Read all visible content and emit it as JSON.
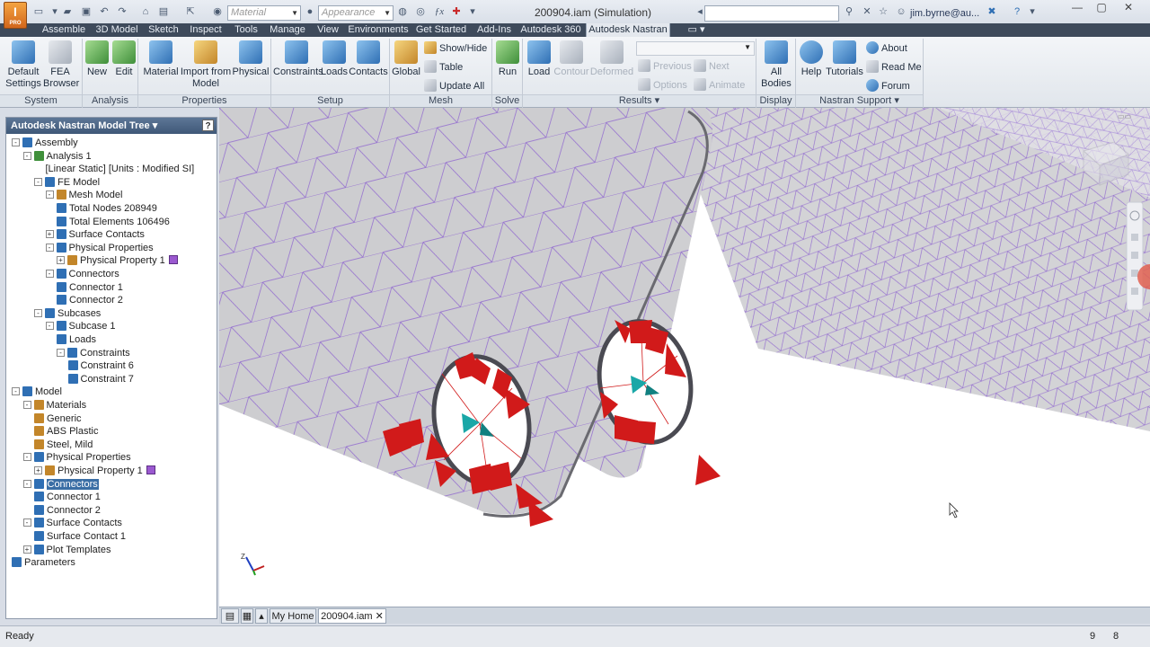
{
  "app": {
    "window_title": "200904.iam (Simulation)",
    "user": "jim.byrne@au...",
    "app_button_label": "PRO",
    "material_placeholder": "Material",
    "appearance_placeholder": "Appearance"
  },
  "tabs": [
    "Assemble",
    "3D Model",
    "Sketch",
    "Inspect",
    "Tools",
    "Manage",
    "View",
    "Environments",
    "Get Started",
    "Add-Ins",
    "Autodesk 360",
    "Autodesk Nastran"
  ],
  "active_tab": "Autodesk Nastran",
  "ribbon": {
    "system": {
      "label": "System",
      "default_settings": "Default Settings",
      "fea_browser": "FEA Browser"
    },
    "analysis": {
      "label": "Analysis",
      "new": "New",
      "edit": "Edit"
    },
    "properties": {
      "label": "Properties",
      "material": "Material",
      "import_from_model": "Import from Model",
      "physical": "Physical"
    },
    "setup": {
      "label": "Setup",
      "constraints": "Constraints",
      "loads": "Loads",
      "contacts": "Contacts"
    },
    "mesh": {
      "label": "Mesh",
      "global": "Global",
      "show_hide": "Show/Hide",
      "table": "Table",
      "update_all": "Update  All"
    },
    "solve": {
      "label": "Solve",
      "run": "Run"
    },
    "results": {
      "label": "Results",
      "load": "Load",
      "contour": "Contour",
      "deformed": "Deformed",
      "previous": "Previous",
      "next": "Next",
      "options": "Options",
      "animate": "Animate"
    },
    "display": {
      "label": "Display",
      "all_bodies": "All Bodies"
    },
    "support": {
      "label": "Nastran Support",
      "help": "Help",
      "tutorials": "Tutorials",
      "about": "About",
      "read_me": "Read Me",
      "forum": "Forum"
    }
  },
  "tree": {
    "header": "Autodesk Nastran Model Tree",
    "help": "?",
    "items": [
      {
        "label": "Assembly",
        "level": 0,
        "exp": "-",
        "icon": "assembly-icon",
        "color": "#2f6fb4"
      },
      {
        "label": "Analysis 1",
        "level": 1,
        "exp": "-",
        "icon": "analysis-icon",
        "color": "#3f8f3a"
      },
      {
        "label": "[Linear Static] [Units : Modified SI]",
        "level": 3,
        "exp": "",
        "icon": "",
        "color": ""
      },
      {
        "label": "FE Model",
        "level": 2,
        "exp": "-",
        "icon": "fe-model-icon",
        "color": "#2f6fb4"
      },
      {
        "label": "Mesh Model",
        "level": 3,
        "exp": "-",
        "icon": "mesh-icon",
        "color": "#c3862a"
      },
      {
        "label": "Total Nodes 208949",
        "level": 4,
        "exp": "",
        "icon": "node-icon",
        "color": "#2f6fb4"
      },
      {
        "label": "Total Elements 106496",
        "level": 4,
        "exp": "",
        "icon": "element-icon",
        "color": "#2f6fb4"
      },
      {
        "label": "Surface Contacts",
        "level": 3,
        "exp": "+",
        "icon": "contact-icon",
        "color": "#2f6fb4"
      },
      {
        "label": "Physical Properties",
        "level": 3,
        "exp": "-",
        "icon": "properties-icon",
        "color": "#2f6fb4"
      },
      {
        "label": "Physical Property 1",
        "level": 4,
        "exp": "+",
        "icon": "property-icon",
        "color": "#c3862a",
        "swatch": true
      },
      {
        "label": "Connectors",
        "level": 3,
        "exp": "-",
        "icon": "connector-icon",
        "color": "#2f6fb4"
      },
      {
        "label": "Connector 1",
        "level": 4,
        "exp": "",
        "icon": "connector-icon",
        "color": "#2f6fb4"
      },
      {
        "label": "Connector 2",
        "level": 4,
        "exp": "",
        "icon": "connector-icon",
        "color": "#2f6fb4"
      },
      {
        "label": "Subcases",
        "level": 2,
        "exp": "-",
        "icon": "subcases-icon",
        "color": "#2f6fb4"
      },
      {
        "label": "Subcase 1",
        "level": 3,
        "exp": "-",
        "icon": "subcase-icon",
        "color": "#2f6fb4"
      },
      {
        "label": "Loads",
        "level": 4,
        "exp": "",
        "icon": "loads-icon",
        "color": "#2f6fb4"
      },
      {
        "label": "Constraints",
        "level": 4,
        "exp": "-",
        "icon": "constraints-icon",
        "color": "#2f6fb4"
      },
      {
        "label": "Constraint 6",
        "level": 5,
        "exp": "",
        "icon": "constraint-icon",
        "color": "#2f6fb4"
      },
      {
        "label": "Constraint 7",
        "level": 5,
        "exp": "",
        "icon": "constraint-icon",
        "color": "#2f6fb4"
      },
      {
        "label": "Model",
        "level": 0,
        "exp": "-",
        "icon": "model-icon",
        "color": "#2f6fb4"
      },
      {
        "label": "Materials",
        "level": 1,
        "exp": "-",
        "icon": "materials-icon",
        "color": "#c3862a"
      },
      {
        "label": "Generic",
        "level": 2,
        "exp": "",
        "icon": "material-icon",
        "color": "#c3862a"
      },
      {
        "label": "ABS Plastic",
        "level": 2,
        "exp": "",
        "icon": "material-icon",
        "color": "#c3862a"
      },
      {
        "label": "Steel, Mild",
        "level": 2,
        "exp": "",
        "icon": "material-icon",
        "color": "#c3862a"
      },
      {
        "label": "Physical Properties",
        "level": 1,
        "exp": "-",
        "icon": "properties-icon",
        "color": "#2f6fb4"
      },
      {
        "label": "Physical Property 1",
        "level": 2,
        "exp": "+",
        "icon": "property-icon",
        "color": "#c3862a",
        "swatch": true
      },
      {
        "label": "Connectors",
        "level": 1,
        "exp": "-",
        "icon": "connector-icon",
        "color": "#2f6fb4",
        "selected": true
      },
      {
        "label": "Connector 1",
        "level": 2,
        "exp": "",
        "icon": "connector-icon",
        "color": "#2f6fb4"
      },
      {
        "label": "Connector 2",
        "level": 2,
        "exp": "",
        "icon": "connector-icon",
        "color": "#2f6fb4"
      },
      {
        "label": "Surface Contacts",
        "level": 1,
        "exp": "-",
        "icon": "contact-icon",
        "color": "#2f6fb4"
      },
      {
        "label": "Surface Contact 1",
        "level": 2,
        "exp": "",
        "icon": "contact-icon",
        "color": "#2f6fb4"
      },
      {
        "label": "Plot Templates",
        "level": 1,
        "exp": "+",
        "icon": "plot-icon",
        "color": "#2f6fb4"
      },
      {
        "label": "Parameters",
        "level": 0,
        "exp": "",
        "icon": "parameters-icon",
        "color": "#2f6fb4"
      }
    ]
  },
  "doc_tabs": {
    "home": "My Home",
    "file": "200904.iam"
  },
  "status": {
    "text": "Ready",
    "num1": "9",
    "num2": "8"
  },
  "colors": {
    "mesh_purple": "#9b6ad6",
    "load_arrow_red": "#d11a1a",
    "connector_teal": "#1aa7a7",
    "swatch_purple": "#9b59d0",
    "tab_active": "#e4e8ee",
    "title_bar": "#e1e6ec"
  }
}
